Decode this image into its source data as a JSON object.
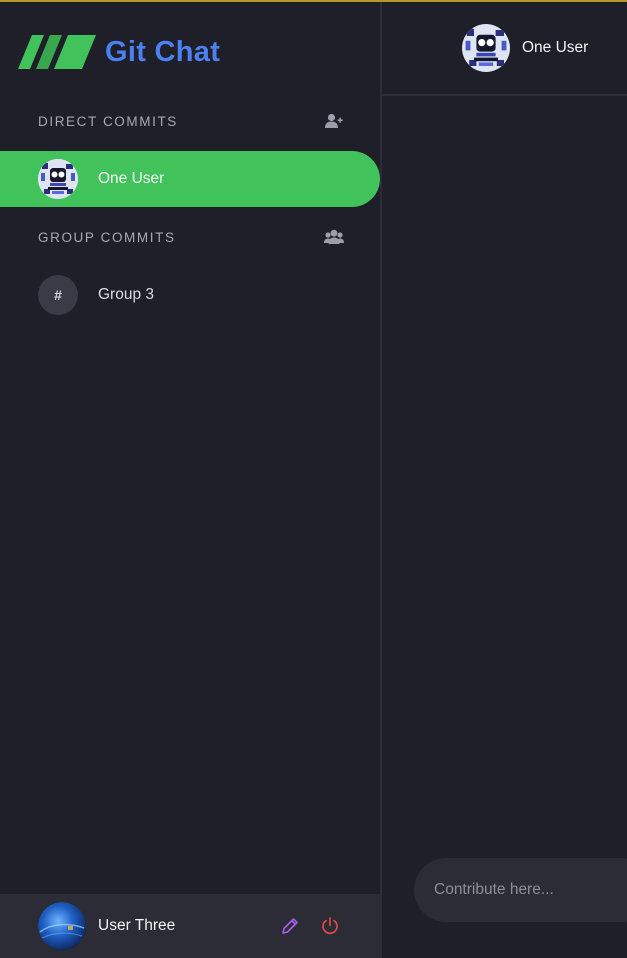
{
  "brand": {
    "title": "Git Chat",
    "logo_icon": "triple-slash-logo",
    "logo_color": "#42c25b",
    "title_color": "#4a80f0"
  },
  "sidebar": {
    "direct_section": {
      "title": "DIRECT COMMITS",
      "action_icon": "add-user-icon"
    },
    "direct_items": [
      {
        "label": "One User",
        "avatar": "pixel-robot-avatar",
        "active": true
      }
    ],
    "group_section": {
      "title": "GROUP COMMITS",
      "action_icon": "group-users-icon"
    },
    "group_items": [
      {
        "label": "Group 3",
        "avatar_text": "#"
      }
    ]
  },
  "footer": {
    "user_name": "User Three",
    "avatar": "blue-planet-avatar",
    "edit_icon": "pencil-icon",
    "logout_icon": "power-icon",
    "edit_color": "#a55ff0",
    "logout_color": "#e04848"
  },
  "chat": {
    "header_name": "One User",
    "header_avatar": "pixel-robot-avatar",
    "composer_placeholder": "Contribute here..."
  },
  "colors": {
    "background": "#1e1f28",
    "active_row": "#42c25b",
    "panel": "#2b2c35"
  }
}
